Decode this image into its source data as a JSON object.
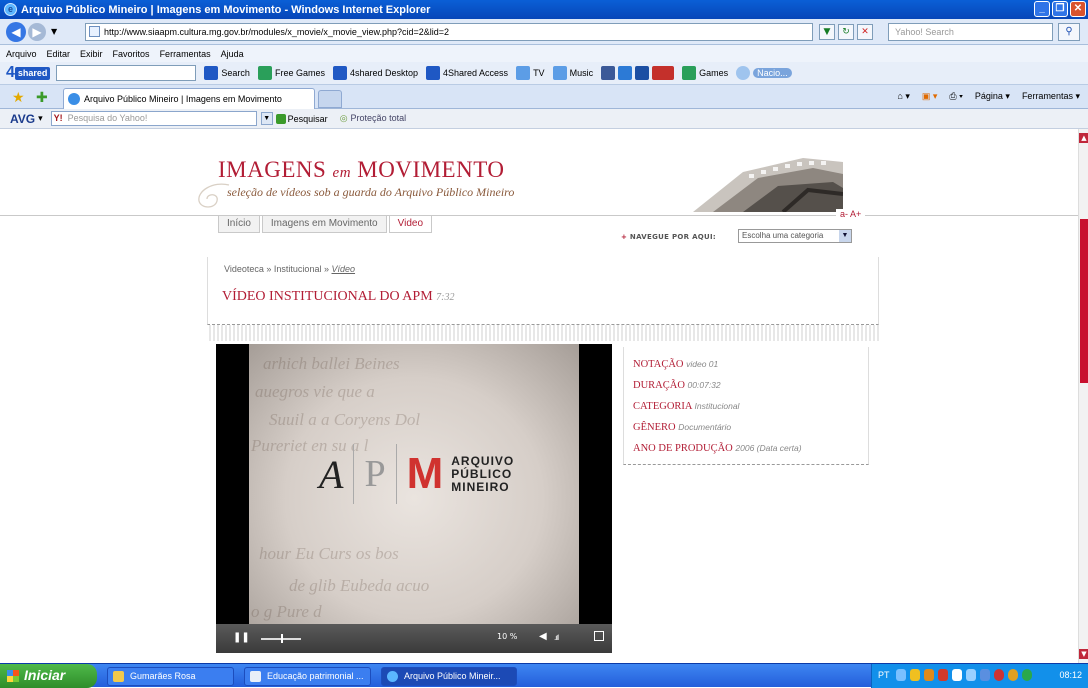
{
  "window": {
    "title": "Arquivo Público Mineiro | Imagens em Movimento - Windows Internet Explorer",
    "buttons": [
      "_",
      "❐",
      "✕"
    ]
  },
  "address_bar": {
    "url": "http://www.siaapm.cultura.mg.gov.br/modules/x_movie/x_movie_view.php?cid=2&lid=2",
    "search_placeholder": "Yahoo! Search"
  },
  "menu": [
    "Arquivo",
    "Editar",
    "Exibir",
    "Favoritos",
    "Ferramentas",
    "Ajuda"
  ],
  "toolbar_4shared": {
    "logo_num": "4",
    "logo_word": "shared",
    "items": [
      "Search",
      "Free Games",
      "4shared Desktop",
      "4Shared Access",
      "TV",
      "Music",
      "Games",
      "Nacio..."
    ]
  },
  "tab": {
    "title": "Arquivo Público Mineiro | Imagens em Movimento",
    "commands": [
      "Página",
      "Ferramentas"
    ]
  },
  "avg_bar": {
    "logo": "AVG",
    "search_placeholder": "Pesquisa do Yahoo!",
    "search_button": "Pesquisar",
    "protection": "Proteção total"
  },
  "site": {
    "title_part1": "IMAGENS",
    "title_em": "em",
    "title_part2": "MOVIMENTO",
    "subtitle": "seleção de vídeos sob a guarda do Arquivo Público Mineiro",
    "text_size": "a-  A+",
    "nav_tabs": [
      "Início",
      "Imagens em Movimento",
      "Video"
    ],
    "navegue_label": "NAVEGUE POR AQUI:",
    "category_select": "Escolha uma categoria",
    "breadcrumb": {
      "first": "Videoteca",
      "second": "Institucional",
      "current": "Vídeo",
      "sep": "»"
    },
    "video_title": "VÍDEO INSTITUCIONAL DO APM",
    "video_duration": "7:32",
    "player": {
      "logo_a": "A",
      "logo_p": "P",
      "logo_m": "M",
      "logo_text": [
        "ARQUIVO",
        "PÚBLICO",
        "MINEIRO"
      ],
      "volume_label": "10 %",
      "progress": 0.18
    },
    "info": [
      {
        "label": "NOTAÇÃO",
        "value": "video 01"
      },
      {
        "label": "DURAÇÃO",
        "value": "00:07:32"
      },
      {
        "label": "CATEGORIA",
        "value": "Institucional"
      },
      {
        "label": "GÊNERO",
        "value": "Documentário"
      },
      {
        "label": "ANO DE PRODUÇÃO",
        "value": "2006 (Data certa)"
      }
    ]
  },
  "taskbar": {
    "start": "Iniciar",
    "tasks": [
      "Gumarães Rosa",
      "Educação patrimonial ...",
      "Arquivo Público Mineir..."
    ],
    "lang": "PT",
    "clock": "08:12"
  }
}
